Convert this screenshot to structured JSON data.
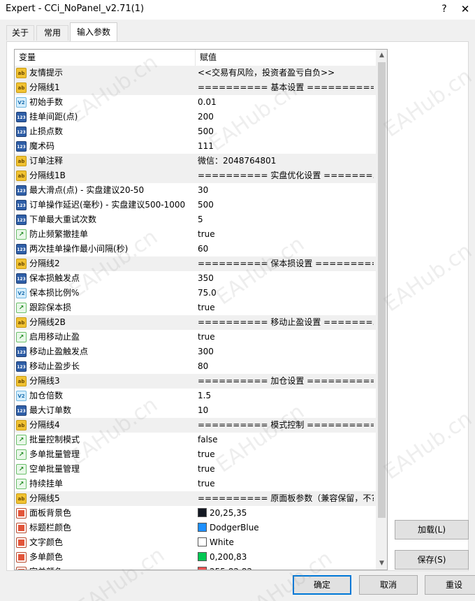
{
  "window": {
    "title": "Expert - CCi_NoPanel_v2.71(1)",
    "help": "?",
    "close": "✕"
  },
  "tabs": [
    "关于",
    "常用",
    "输入参数"
  ],
  "grid": {
    "col_variable": "变量",
    "col_value": "赋值",
    "rows": [
      {
        "type": "ab",
        "name": "友情提示",
        "value": "<<交易有风险，投资者盈亏自负>>"
      },
      {
        "type": "ab",
        "name": "分隔线1",
        "value": "========== 基本设置 =========="
      },
      {
        "type": "v2",
        "name": "初始手数",
        "value": "0.01"
      },
      {
        "type": "123",
        "name": "挂单间距(点)",
        "value": "200"
      },
      {
        "type": "123",
        "name": "止损点数",
        "value": "500"
      },
      {
        "type": "123",
        "name": "魔术码",
        "value": "111"
      },
      {
        "type": "ab",
        "name": "订单注释",
        "value": "微信：2048764801"
      },
      {
        "type": "ab",
        "name": "分隔线1B",
        "value": "========== 实盘优化设置 =======..."
      },
      {
        "type": "123",
        "name": "最大滑点(点) - 实盘建议20-50",
        "value": "30"
      },
      {
        "type": "123",
        "name": "订单操作延迟(毫秒) - 实盘建议500-1000",
        "value": "500"
      },
      {
        "type": "123",
        "name": "下单最大重试次数",
        "value": "5"
      },
      {
        "type": "bool",
        "name": "防止频繁撤挂单",
        "value": "true"
      },
      {
        "type": "123",
        "name": "两次挂单操作最小间隔(秒)",
        "value": "60"
      },
      {
        "type": "ab",
        "name": "分隔线2",
        "value": "========== 保本损设置 =========="
      },
      {
        "type": "123",
        "name": "保本损触发点",
        "value": "350"
      },
      {
        "type": "v2",
        "name": "保本损比例%",
        "value": "75.0"
      },
      {
        "type": "bool",
        "name": "跟踪保本损",
        "value": "true"
      },
      {
        "type": "ab",
        "name": "分隔线2B",
        "value": "========== 移动止盈设置 =======..."
      },
      {
        "type": "bool",
        "name": "启用移动止盈",
        "value": "true"
      },
      {
        "type": "123",
        "name": "移动止盈触发点",
        "value": "300"
      },
      {
        "type": "123",
        "name": "移动止盈步长",
        "value": "80"
      },
      {
        "type": "ab",
        "name": "分隔线3",
        "value": "========== 加仓设置 =========="
      },
      {
        "type": "v2",
        "name": "加仓倍数",
        "value": "1.5"
      },
      {
        "type": "123",
        "name": "最大订单数",
        "value": "10"
      },
      {
        "type": "ab",
        "name": "分隔线4",
        "value": "========== 模式控制 =========="
      },
      {
        "type": "bool",
        "name": "批量控制模式",
        "value": "false"
      },
      {
        "type": "bool",
        "name": "多单批量管理",
        "value": "true"
      },
      {
        "type": "bool",
        "name": "空单批量管理",
        "value": "true"
      },
      {
        "type": "bool",
        "name": "持续挂单",
        "value": "true"
      },
      {
        "type": "ab",
        "name": "分隔线5",
        "value": "========== 原面板参数（兼容保留，不?..."
      },
      {
        "type": "color",
        "name": "面板背景色",
        "value": "20,25,35",
        "color": "#141923"
      },
      {
        "type": "color",
        "name": "标题栏颜色",
        "value": "DodgerBlue",
        "color": "#1e90ff"
      },
      {
        "type": "color",
        "name": "文字颜色",
        "value": "White",
        "color": "#ffffff"
      },
      {
        "type": "color",
        "name": "多单颜色",
        "value": "0,200,83",
        "color": "#00c853"
      }
    ],
    "partial_row": {
      "name": "空单颜色",
      "value": "255,82,82",
      "color": "#ff5252"
    }
  },
  "buttons": {
    "load": "加载(L)",
    "save": "保存(S)",
    "ok": "确定",
    "cancel": "取消",
    "reset": "重设"
  },
  "watermark": "EAHub.cn"
}
